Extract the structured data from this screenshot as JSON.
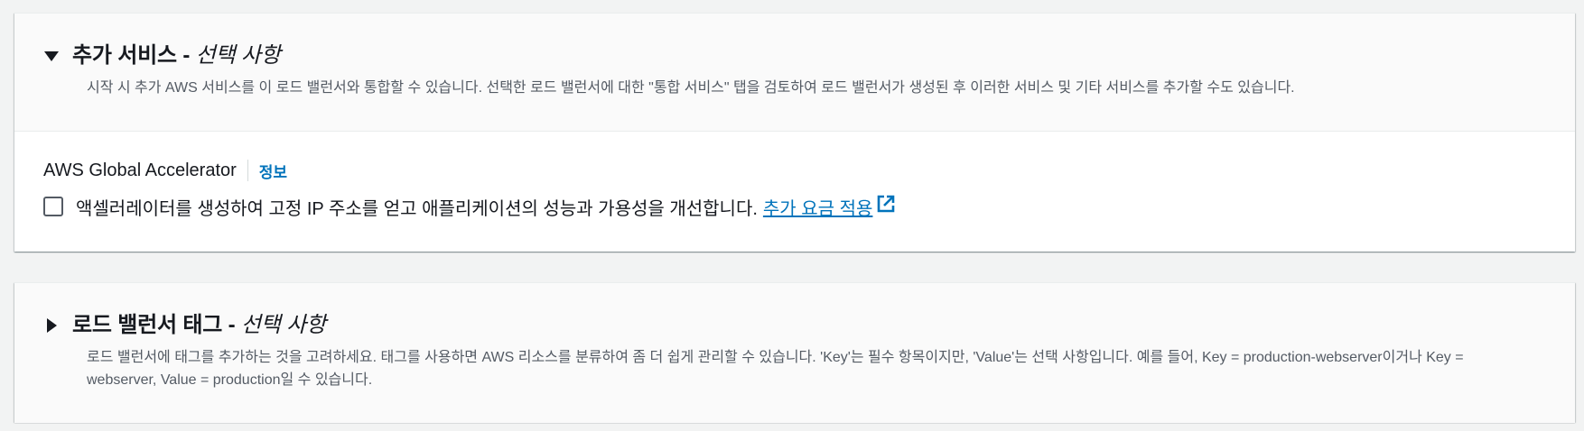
{
  "additional_services": {
    "title": "추가 서비스",
    "separator": " - ",
    "optional": "선택 사항",
    "expanded": true,
    "description": "시작 시 추가 AWS 서비스를 이 로드 밸런서와 통합할 수 있습니다. 선택한 로드 밸런서에 대한 \"통합 서비스\" 탭을 검토하여 로드 밸런서가 생성된 후 이러한 서비스 및 기타 서비스를 추가할 수도 있습니다.",
    "global_accelerator": {
      "label": "AWS Global Accelerator",
      "info_label": "정보",
      "checkbox_checked": false,
      "checkbox_text": "액셀러레이터를 생성하여 고정 IP 주소를 얻고 애플리케이션의 성능과 가용성을 개선합니다.",
      "link_text": "추가 요금 적용",
      "link_icon": "external-link-icon"
    }
  },
  "load_balancer_tags": {
    "title": "로드 밸런서 태그",
    "separator": " - ",
    "optional": "선택 사항",
    "expanded": false,
    "description": "로드 밸런서에 태그를 추가하는 것을 고려하세요. 태그를 사용하면 AWS 리소스를 분류하여 좀 더 쉽게 관리할 수 있습니다. 'Key'는 필수 항목이지만, 'Value'는 선택 사항입니다. 예를 들어, Key = production-webserver이거나 Key = webserver, Value = production일 수 있습니다."
  },
  "colors": {
    "link": "#0073bb",
    "text": "#16191f",
    "muted": "#545b64",
    "background": "#f2f3f3"
  }
}
